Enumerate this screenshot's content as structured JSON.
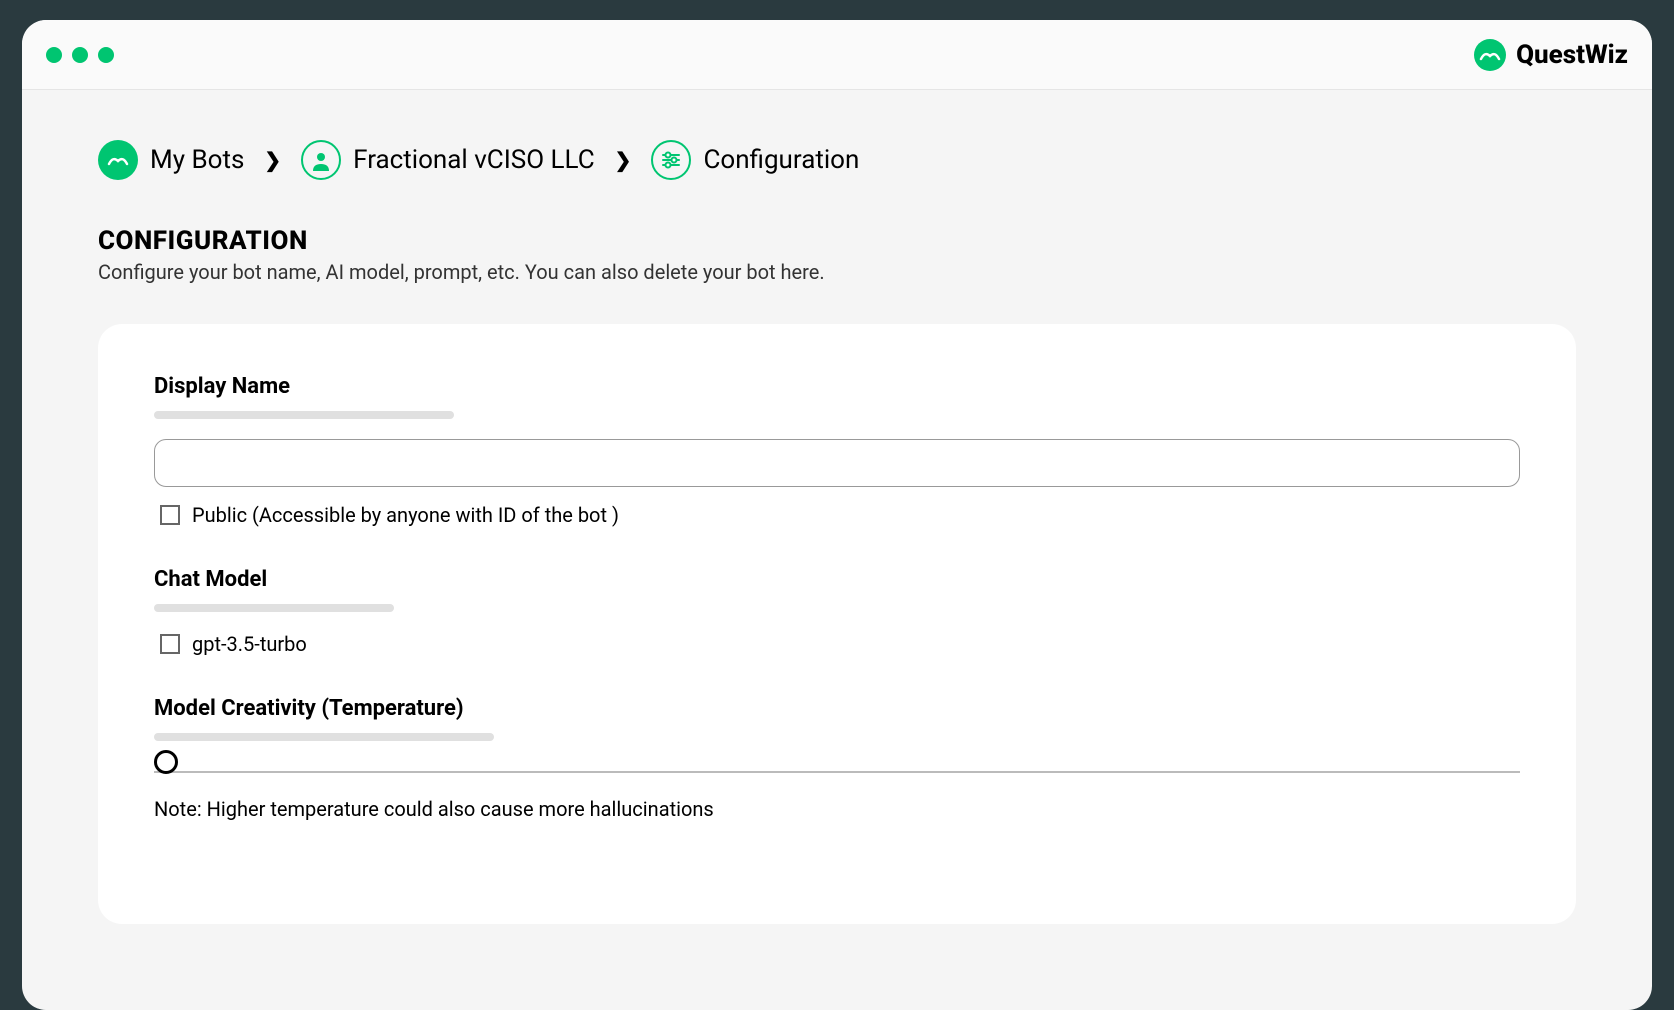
{
  "brand": {
    "name": "QuestWiz"
  },
  "breadcrumb": {
    "item1": "My Bots",
    "item2": "Fractional vCISO LLC",
    "item3": "Configuration"
  },
  "page": {
    "title": "CONFIGURATION",
    "subtitle": "Configure your bot name, AI model, prompt, etc. You can also delete your bot here."
  },
  "form": {
    "displayName": {
      "label": "Display Name",
      "value": ""
    },
    "publicCheckbox": {
      "label": "Public (Accessible by anyone with ID of the bot )",
      "checked": false
    },
    "chatModel": {
      "label": "Chat Model",
      "option": "gpt-3.5-turbo",
      "checked": false
    },
    "temperature": {
      "label": "Model Creativity (Temperature)",
      "value": 0,
      "note": "Note: Higher temperature  could also cause more hallucinations"
    }
  }
}
